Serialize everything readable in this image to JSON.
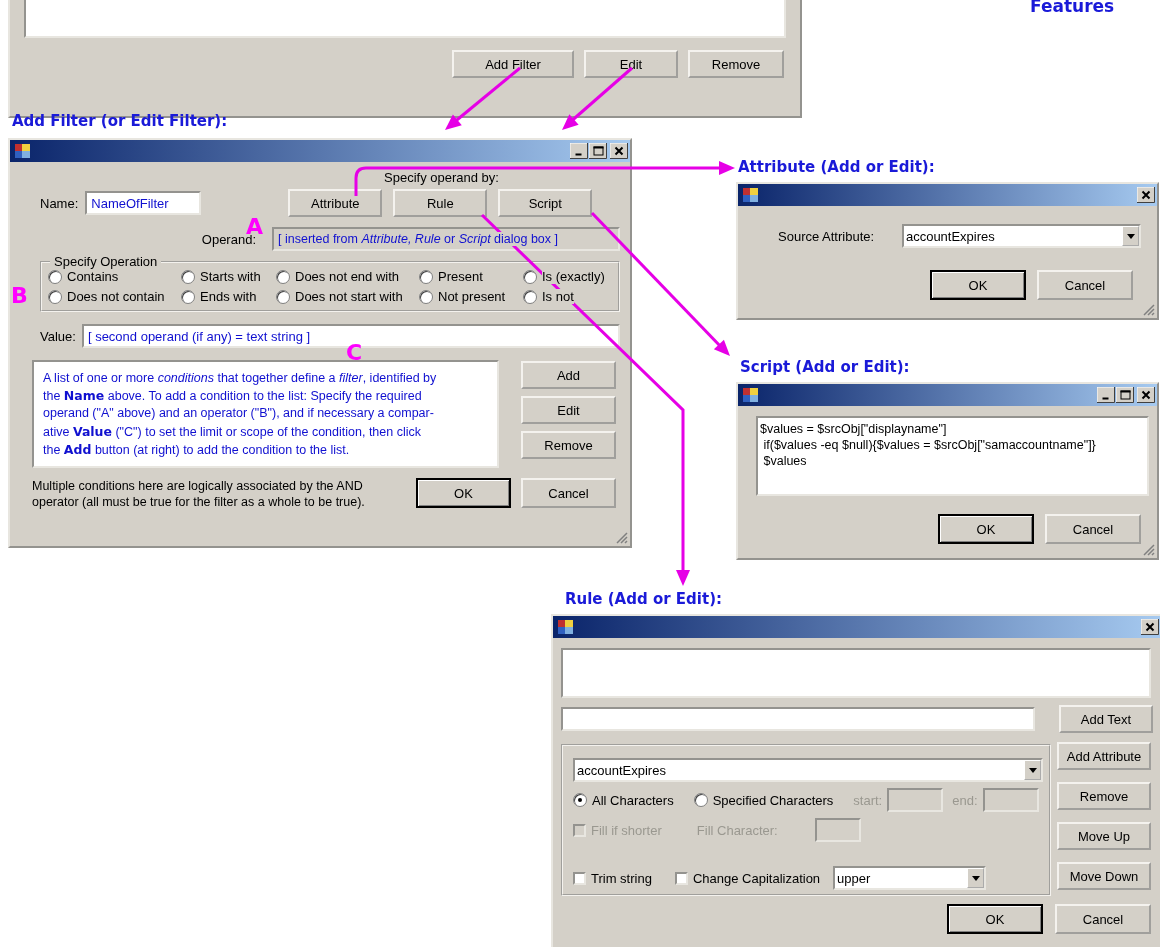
{
  "top_panel": {
    "buttons": [
      "Add Filter",
      "Edit",
      "Remove"
    ]
  },
  "heading": "Features",
  "add_filter": {
    "caption": "Add Filter (or Edit Filter):",
    "minimize_box": true,
    "maximize_box": true,
    "operand_prompt": "Specify operand by:",
    "name_label": "Name:",
    "name_value": "NameOfFilter",
    "operand_buttons": [
      "Attribute",
      "Rule",
      "Script"
    ],
    "operand_label": "Operand:",
    "operand_value": "[ inserted from *Attribute, Rule* or *Script* dialog box ]",
    "markers": [
      "A",
      "B",
      "C"
    ],
    "operation_group": "Specify Operation",
    "operations": [
      {
        "label": "Contains",
        "selected": false
      },
      {
        "label": "Starts with",
        "selected": false
      },
      {
        "label": "Does not end with",
        "selected": false
      },
      {
        "label": "Present",
        "selected": false
      },
      {
        "label": "Is (exactly)",
        "selected": false
      },
      {
        "label": "Does not contain",
        "selected": false
      },
      {
        "label": "Ends with",
        "selected": false
      },
      {
        "label": "Does not start with",
        "selected": false
      },
      {
        "label": "Not present",
        "selected": false
      },
      {
        "label": "Is not",
        "selected": false
      }
    ],
    "value_label": "Value:",
    "value_value": "[ second operand (if any) = text string ]",
    "description": "A list of one or more *conditions* that together define a *filter*, identified by\nthe **Name** above.  To add a condition to the list:  Specify the required\noperand (\"A\" above) and an operator (\"B\"), and if necessary a compar-\native **Value** (\"C\") to set the limit or scope of the condition, then click\nthe **Add** button (at right) to add the condition to the list.",
    "list_buttons": [
      "Add",
      "Edit",
      "Remove"
    ],
    "note": "Multiple conditions here are logically associated by the AND\noperator (all must be true for the filter as a whole to be true).",
    "ok": "OK",
    "cancel": "Cancel"
  },
  "attribute_dialog": {
    "caption": "Attribute (Add or Edit):",
    "minimize_box": false,
    "maximize_box": false,
    "source_label": "Source Attribute:",
    "source_value": "accountExpires",
    "ok": "OK",
    "cancel": "Cancel"
  },
  "script_dialog": {
    "caption": "Script (Add or Edit):",
    "minimize_box": true,
    "maximize_box": true,
    "script": "$values = $srcObj[\"displayname\"]\n if($values -eq $null){$values = $srcObj[\"samaccountname\"]}\n $values",
    "ok": "OK",
    "cancel": "Cancel"
  },
  "rule_dialog": {
    "caption": "Rule (Add or Edit):",
    "minimize_box": false,
    "maximize_box": false,
    "buttons": [
      "Add Text",
      "Add Attribute",
      "Remove",
      "Move Up",
      "Move Down"
    ],
    "attribute_value": "accountExpires",
    "char_options": [
      {
        "label": "All Characters",
        "selected": true
      },
      {
        "label": "Specified Characters",
        "selected": false
      }
    ],
    "range": {
      "start_label": "start:",
      "end_label": "end:",
      "disabled": true
    },
    "fill_if_shorter": {
      "label": "Fill if shorter",
      "checked": false,
      "disabled": true
    },
    "fill_character": {
      "label": "Fill Character:",
      "disabled": true
    },
    "trim": {
      "label": "Trim string",
      "checked": false
    },
    "change_capitalization": {
      "label": "Change Capitalization",
      "checked": false
    },
    "capitalization_value": "upper",
    "ok": "OK",
    "cancel": "Cancel"
  }
}
